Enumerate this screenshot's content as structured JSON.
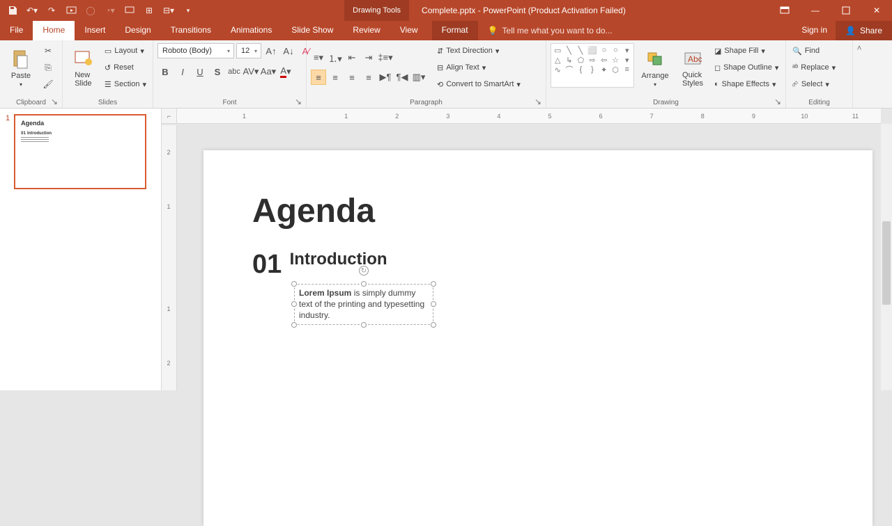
{
  "titlebar": {
    "contextual_tab": "Drawing Tools",
    "title": "Complete.pptx - PowerPoint (Product Activation Failed)"
  },
  "tabs": {
    "file": "File",
    "home": "Home",
    "insert": "Insert",
    "design": "Design",
    "transitions": "Transitions",
    "animations": "Animations",
    "slideshow": "Slide Show",
    "review": "Review",
    "view": "View",
    "format": "Format",
    "tellme": "Tell me what you want to do...",
    "signin": "Sign in",
    "share": "Share"
  },
  "ribbon": {
    "clipboard": {
      "paste": "Paste",
      "label": "Clipboard"
    },
    "slides": {
      "new_slide": "New\nSlide",
      "layout": "Layout",
      "reset": "Reset",
      "section": "Section",
      "label": "Slides"
    },
    "font": {
      "family": "Roboto (Body)",
      "size": "12",
      "label": "Font"
    },
    "paragraph": {
      "label": "Paragraph",
      "text_direction": "Text Direction",
      "align_text": "Align Text",
      "convert_smartart": "Convert to SmartArt"
    },
    "drawing": {
      "arrange": "Arrange",
      "quick_styles": "Quick\nStyles",
      "shape_fill": "Shape Fill",
      "shape_outline": "Shape Outline",
      "shape_effects": "Shape Effects",
      "label": "Drawing"
    },
    "editing": {
      "find": "Find",
      "replace": "Replace",
      "select": "Select",
      "label": "Editing"
    }
  },
  "slide_panel": {
    "num": "1",
    "thumb_title": "Agenda",
    "thumb_num": "01",
    "thumb_heading": "Introduction"
  },
  "slide": {
    "title": "Agenda",
    "num": "01",
    "heading": "Introduction",
    "body_strong": "Lorem Ipsum",
    "body_rest": " is simply dummy text of the printing and typesetting industry."
  },
  "ruler": {
    "ticks": [
      "1",
      "",
      "1",
      "2",
      "3",
      "4",
      "5",
      "6",
      "7",
      "8",
      "9",
      "10",
      "11"
    ]
  }
}
